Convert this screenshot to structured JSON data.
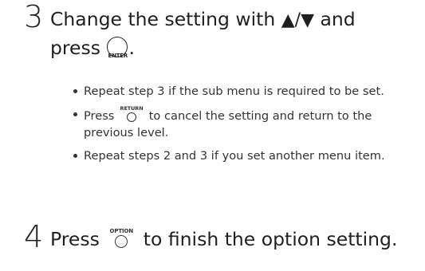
{
  "step3": {
    "number": "3",
    "text_part1": "Change the setting with ",
    "arrows": "▲/▼",
    "text_part2": " and",
    "line2_part1": "press ",
    "enter_icon_label": "ENTER",
    "line2_part2": ".",
    "bullets": [
      {
        "text": "Repeat step 3 if the sub menu is required to be set."
      },
      {
        "text_before": "Press ",
        "icon_label": "RETURN",
        "text_after": " to cancel the setting and return to the previous level."
      },
      {
        "text": "Repeat steps 2 and 3 if you set another menu item."
      }
    ]
  },
  "step4": {
    "number": "4",
    "text_before": "Press ",
    "icon_label": "OPTION",
    "text_after": " to finish the option setting."
  },
  "icons": {
    "arrows": "up-down-triangle-icon",
    "enter": "enter-button-icon",
    "return": "return-button-icon",
    "option": "option-button-icon"
  }
}
